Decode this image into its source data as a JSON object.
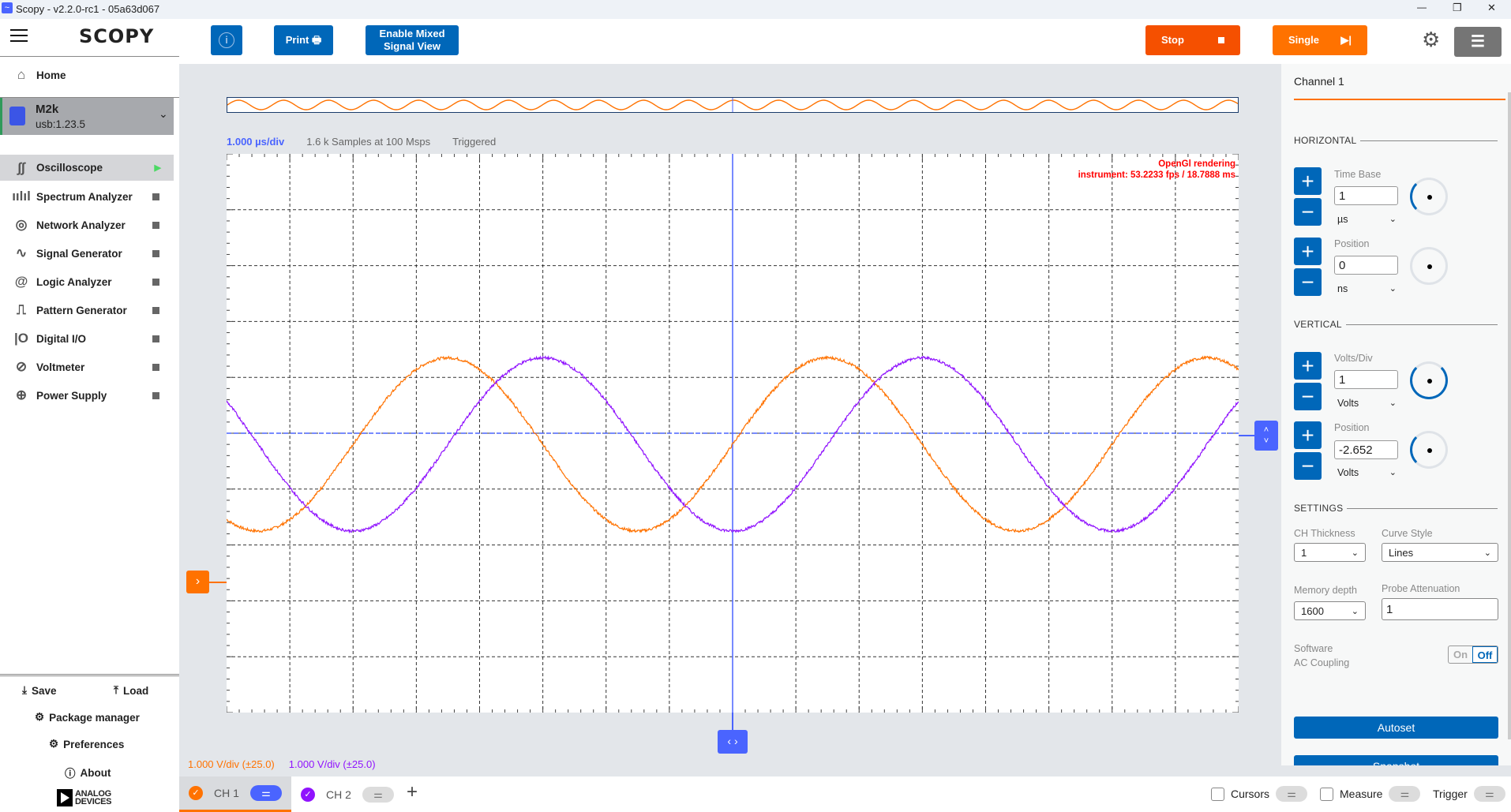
{
  "window": {
    "title": "Scopy - v2.2.0-rc1 - 05a63d067",
    "minimize": "—",
    "restore": "❐",
    "close": "✕"
  },
  "sidebar": {
    "logo": "SCOPY",
    "home": "Home",
    "device": {
      "name": "M2k",
      "uri": "usb:1.23.5"
    },
    "tools": [
      {
        "label": "Oscilloscope",
        "icon": "oscilloscope-icon",
        "glyph": "∫∫",
        "running": true
      },
      {
        "label": "Spectrum Analyzer",
        "icon": "spectrum-icon",
        "glyph": "ıılıl"
      },
      {
        "label": "Network Analyzer",
        "icon": "network-icon",
        "glyph": "◎"
      },
      {
        "label": "Signal Generator",
        "icon": "signal-icon",
        "glyph": "∿"
      },
      {
        "label": "Logic Analyzer",
        "icon": "logic-icon",
        "glyph": "@"
      },
      {
        "label": "Pattern Generator",
        "icon": "pattern-icon",
        "glyph": "⎍"
      },
      {
        "label": "Digital I/O",
        "icon": "digital-io-icon",
        "glyph": "|O"
      },
      {
        "label": "Voltmeter",
        "icon": "voltmeter-icon",
        "glyph": "⊘"
      },
      {
        "label": "Power Supply",
        "icon": "power-icon",
        "glyph": "⊕"
      }
    ],
    "save": "Save",
    "load": "Load",
    "package_manager": "Package manager",
    "preferences": "Preferences",
    "about": "About",
    "brand": "ANALOG DEVICES"
  },
  "toolbar": {
    "print": "Print",
    "mixed": "Enable Mixed Signal View",
    "stop": "Stop",
    "single": "Single"
  },
  "plot": {
    "time_div": "1.000 µs/div",
    "samples": "1.6 k Samples at 100 Msps",
    "status": "Triggered",
    "render_line1": "OpenGl rendering",
    "render_line2": "instrument: 53.2233 fps / 18.7888 ms",
    "ch1_scale": "1.000 V/div (±25.0)",
    "ch2_scale": "1.000 V/div (±25.0)"
  },
  "colors": {
    "ch1": "#ff7200",
    "ch2": "#9013fe",
    "accent": "#0067b9",
    "stop": "#f55000",
    "single": "#ff7200",
    "marker": "#4a64ff"
  },
  "chart_data": {
    "type": "line",
    "x_unit": "µs",
    "y_unit": "V",
    "xlim": [
      -8,
      8
    ],
    "ylim": [
      -5,
      5
    ],
    "x_divisions": 16,
    "y_divisions": 10,
    "grid": true,
    "series": [
      {
        "name": "CH1",
        "shape": "sine",
        "amplitude": 1.55,
        "period": 6,
        "delay": 0,
        "offset": -0.2
      },
      {
        "name": "CH2",
        "shape": "sine",
        "amplitude": 1.55,
        "period": 6,
        "delay": 1.5,
        "offset": -0.2
      }
    ]
  },
  "channels": {
    "tabs": [
      {
        "label": "CH 1"
      },
      {
        "label": "CH 2"
      }
    ],
    "add": "+"
  },
  "bottom": {
    "cursors": "Cursors",
    "measure": "Measure",
    "trigger": "Trigger"
  },
  "panel": {
    "title": "Channel 1",
    "horizontal": "HORIZONTAL",
    "vertical": "VERTICAL",
    "settings": "SETTINGS",
    "time_base": {
      "label": "Time Base",
      "value": "1",
      "unit": "µs"
    },
    "h_position": {
      "label": "Position",
      "value": "0",
      "unit": "ns"
    },
    "volts_div": {
      "label": "Volts/Div",
      "value": "1",
      "unit": "Volts"
    },
    "v_position": {
      "label": "Position",
      "value": "-2.652",
      "unit": "Volts"
    },
    "ch_thickness": {
      "label": "CH Thickness",
      "value": "1"
    },
    "curve_style": {
      "label": "Curve Style",
      "value": "Lines"
    },
    "memory_depth": {
      "label": "Memory depth",
      "value": "1600"
    },
    "probe_att": {
      "label": "Probe Attenuation",
      "value": "1"
    },
    "ac_coupling": {
      "label1": "Software",
      "label2": "AC Coupling",
      "on": "On",
      "off": "Off",
      "state": "Off"
    },
    "autoset": "Autoset",
    "snapshot": "Snapshot"
  }
}
